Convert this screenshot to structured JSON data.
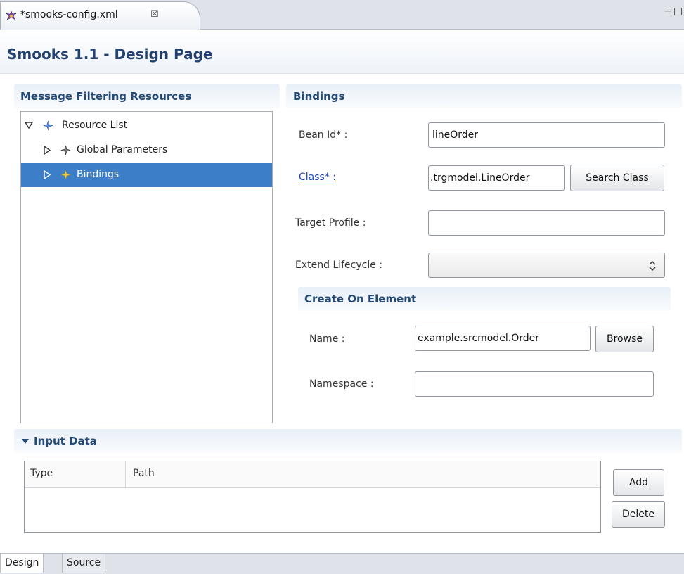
{
  "editor_tab": {
    "title": "*smooks-config.xml",
    "close": "☒"
  },
  "window_controls": {
    "minimize": "−",
    "maximize": "□"
  },
  "page_title": "Smooks 1.1 - Design Page",
  "left_section": {
    "title": "Message Filtering Resources",
    "tree": [
      {
        "label": "Resource List",
        "expanded": true,
        "level": 0
      },
      {
        "label": "Global Parameters",
        "expanded": false,
        "level": 1
      },
      {
        "label": "Bindings",
        "expanded": false,
        "level": 1,
        "selected": true
      }
    ]
  },
  "bindings_section": {
    "title": "Bindings",
    "bean_id": {
      "label": "Bean Id* :",
      "value": "lineOrder"
    },
    "class": {
      "label": "Class* :",
      "value": ".trgmodel.LineOrder",
      "button": "Search Class"
    },
    "target_profile": {
      "label": "Target Profile :",
      "value": ""
    },
    "extend_lifecycle": {
      "label": "Extend Lifecycle :",
      "value": ""
    },
    "create_on_element": {
      "title": "Create On Element",
      "name": {
        "label": "Name :",
        "value": "example.srcmodel.Order",
        "button": "Browse"
      },
      "namespace": {
        "label": "Namespace :",
        "value": ""
      }
    }
  },
  "input_data": {
    "title": "Input Data",
    "columns": [
      "Type",
      "Path"
    ],
    "rows": [],
    "add_button": "Add",
    "delete_button": "Delete"
  },
  "bottom_tabs": [
    {
      "label": "Design",
      "active": true
    },
    {
      "label": "Source",
      "active": false
    }
  ],
  "colors": {
    "title": "#24426f",
    "section_title": "#254a75",
    "selection": "#3c7ec8",
    "link": "#1b3fae"
  }
}
